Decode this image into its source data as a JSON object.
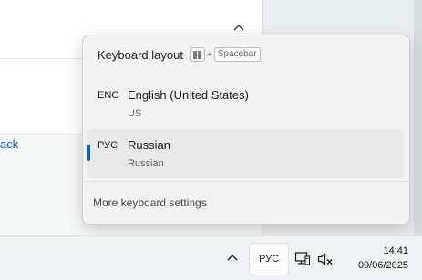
{
  "background_window": {
    "link_text": "ack"
  },
  "flyout": {
    "title": "Keyboard layout",
    "shortcut_plus": "+",
    "shortcut_key": "Spacebar",
    "layouts": [
      {
        "code": "ENG",
        "name": "English (United States)",
        "sub": "US",
        "selected": false
      },
      {
        "code": "РУС",
        "name": "Russian",
        "sub": "Russian",
        "selected": true
      }
    ],
    "more_settings": "More keyboard settings"
  },
  "taskbar": {
    "language_indicator": "РУС",
    "time": "14:41",
    "date": "09/06/2025"
  },
  "colors": {
    "accent": "#005fb8",
    "flyout_bg": "#f3f3f3",
    "selected_bg": "#e9e9e9"
  }
}
